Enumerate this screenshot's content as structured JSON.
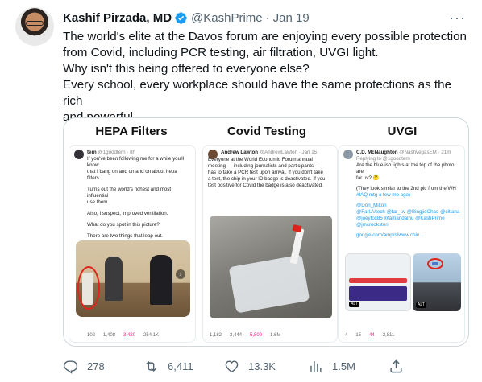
{
  "tweet": {
    "display_name": "Kashif Pirzada, MD",
    "handle": "@KashPrime",
    "separator": "·",
    "date": "Jan 19",
    "more_label": "···",
    "lines": [
      "The world's elite at the Davos forum are enjoying every possible protection",
      "from Covid, including PCR testing, air filtration, UVGI light.",
      "Why isn't this being offered to everyone else?",
      "Every school, every workplace should have the same protections as the rich",
      "and powerful."
    ]
  },
  "media": {
    "columns": [
      {
        "title": "HEPA Filters",
        "tweet": {
          "user": "tern",
          "handle": "@1goodtern · 8h",
          "text": [
            "If you've been following me for a while you'll know",
            "that I bang on and on and on about hepa filters.",
            "",
            "Turns out the world's richest and most influential",
            "use them.",
            "",
            "Also, I suspect, improved ventilation.",
            "",
            "What do you spot in this picture?",
            "",
            "There are two things that leap out."
          ],
          "stats": [
            "102",
            "1,408",
            "3,420",
            "254.1K"
          ]
        }
      },
      {
        "title": "Covid Testing",
        "tweet": {
          "user": "Andrew Lawton",
          "handle": "@AndrewLawton · Jan 15",
          "text": [
            "Everyone at the World Economic Forum annual",
            "meeting — including journalists and participants —",
            "has to take a PCR test upon arrival. If you don't take",
            "a test, the chip in your ID badge is deactivated. If you",
            "test positive for Covid the badge is also deactivated."
          ],
          "stats": [
            "1,182",
            "3,444",
            "5,800",
            "1.6M"
          ]
        }
      },
      {
        "title": "UVGI",
        "tweet": {
          "user": "C.D. McNaughton",
          "handle": "@NashvegasEM · 21m",
          "replying": "Replying to @1goodtern",
          "text": [
            "Are the blue-ish lights at the top of the photo are",
            "far uv? 🤔",
            "",
            "(They look similar to the 2nd pic from the WH",
            "#IAQ mtg a few mo ago)",
            "",
            "@Don_Milton",
            "@FarUVtech @far_uv @BingjieChao @cltiana",
            "@joeyfox85 @amandalhu @KashPrime",
            "@jmcrookston",
            "",
            "google.com/amp/s/www.coin..."
          ],
          "alt_label": "ALT",
          "stats": [
            "4",
            "15",
            "44",
            "2,811"
          ]
        }
      }
    ]
  },
  "actions": {
    "replies": "278",
    "retweets": "6,411",
    "likes": "13.3K",
    "views": "1.5M"
  },
  "colors": {
    "text": "#0f1419",
    "muted": "#536471",
    "verified": "#1d9bf0",
    "border": "#cfd9de"
  }
}
